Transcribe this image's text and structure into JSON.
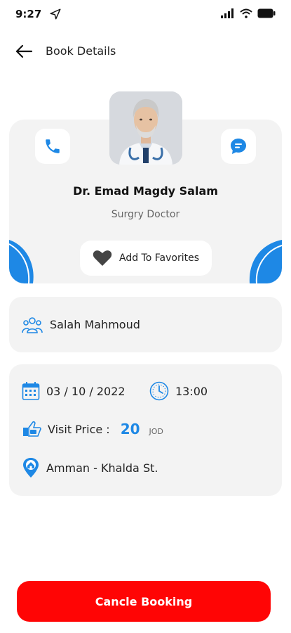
{
  "status_bar": {
    "time": "9:27"
  },
  "header": {
    "title": "Book Details"
  },
  "doctor": {
    "name": "Dr. Emad Magdy Salam",
    "specialty": "Surgry Doctor",
    "favorite_label": "Add To Favorites"
  },
  "patient": {
    "name": "Salah Mahmoud"
  },
  "booking": {
    "date": "03 / 10 / 2022",
    "time": "13:00",
    "price_label": "Visit Price :",
    "price_value": "20",
    "price_currency": "JOD",
    "location": "Amman - Khalda St."
  },
  "actions": {
    "cancel_label": "Cancle Booking"
  },
  "colors": {
    "accent": "#1e88e5",
    "danger": "#ff0505",
    "card": "#f3f3f3"
  },
  "icons": [
    "location-arrow-icon",
    "signal-icon",
    "wifi-icon",
    "battery-icon",
    "back-arrow-icon",
    "phone-icon",
    "chat-icon",
    "heart-icon",
    "users-icon",
    "calendar-icon",
    "clock-icon",
    "price-tag-icon",
    "map-pin-icon"
  ]
}
